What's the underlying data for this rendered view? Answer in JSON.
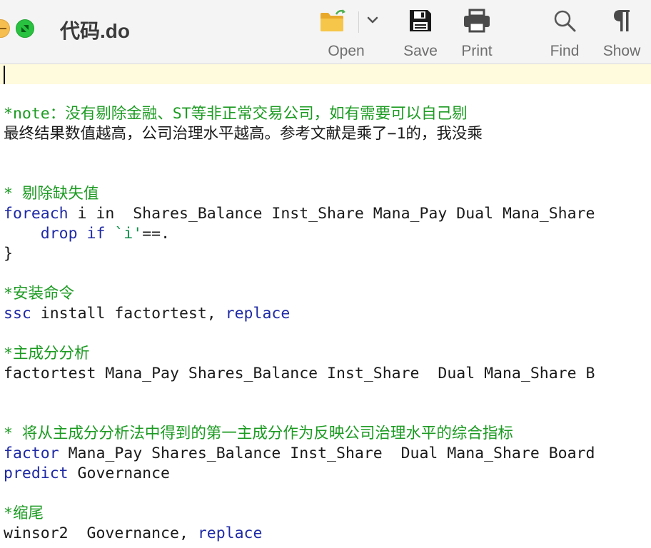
{
  "window": {
    "title": "代码.do"
  },
  "toolbar": {
    "open_label": "Open",
    "save_label": "Save",
    "print_label": "Print",
    "find_label": "Find",
    "show_label": "Show",
    "icons": {
      "open": "folder-open-icon",
      "save": "floppy-disk-icon",
      "print": "printer-icon",
      "find": "magnifier-icon",
      "show": "pilcrow-icon",
      "dropdown": "chevron-down-icon"
    }
  },
  "editor": {
    "lines": {
      "l1_note": "*note：没有剔除金融、ST等非正常交易公司，如有需要可以自己剔",
      "l2_text": "最终结果数值越高，公司治理水平越高。参考文献是乘了−1的，我没乘",
      "l3_comment": "* 剔除缺失值",
      "l4_kw": "foreach",
      "l4_rest": " i in  Shares_Balance Inst_Share Mana_Pay Dual Mana_Share",
      "l5_indent": "    ",
      "l5_kw1": "drop",
      "l5_sp": " ",
      "l5_kw2": "if",
      "l5_sp2": " ",
      "l5_str": "`i'",
      "l5_rest": "==.",
      "l6_brace": "}",
      "l7_comment": "*安装命令",
      "l8_kw": "ssc",
      "l8_rest": " install factortest, ",
      "l8_opt": "replace",
      "l9_comment": "*主成分分析",
      "l10_text": "factortest Mana_Pay Shares_Balance Inst_Share  Dual Mana_Share B",
      "l11_comment": "* 将从主成分分析法中得到的第一主成分作为反映公司治理水平的综合指标",
      "l12_kw": "factor",
      "l12_rest": " Mana_Pay Shares_Balance Inst_Share  Dual Mana_Share Board",
      "l13_kw": "predict",
      "l13_rest": " Governance",
      "l14_comment": "*缩尾",
      "l15_text": "winsor2  Governance, ",
      "l15_opt": "replace"
    }
  },
  "colors": {
    "comment": "#1c9b22",
    "keyword": "#1f2aa6",
    "string": "#0f8f4a",
    "current_line": "#fffbdc",
    "toolbar_bg": "#f5f4f4"
  }
}
